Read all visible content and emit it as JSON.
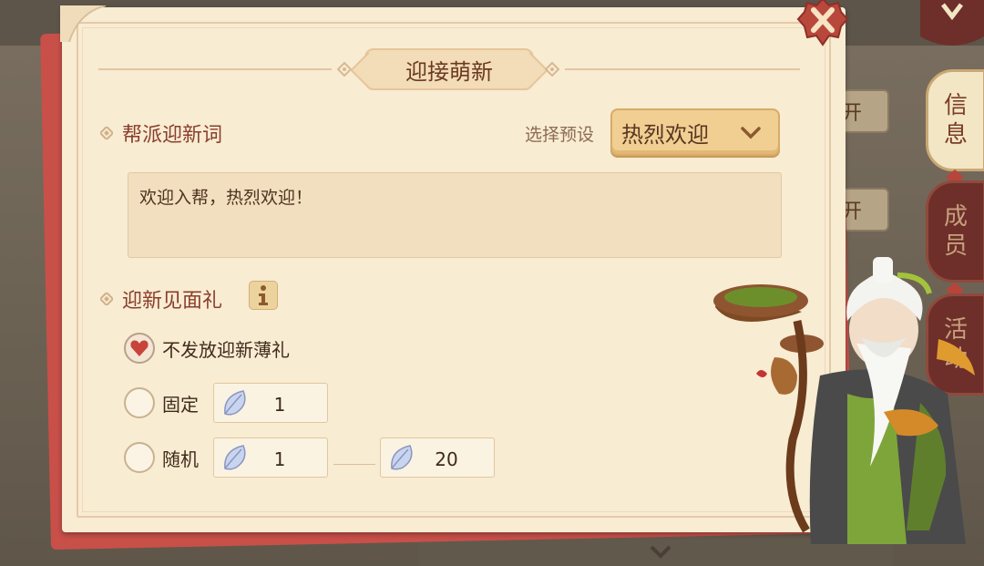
{
  "background": {
    "open_button_1": "开",
    "open_button_2": "开"
  },
  "side_tabs": [
    {
      "label_1": "信",
      "label_2": "息",
      "active": true
    },
    {
      "label_1": "成",
      "label_2": "员",
      "active": false
    },
    {
      "label_1": "活",
      "label_2": "动",
      "active": false
    }
  ],
  "dialog": {
    "title": "迎接萌新",
    "close_icon": "close-x-icon",
    "welcome_section": {
      "heading": "帮派迎新词",
      "preset_label": "选择预设",
      "preset_selected": "热烈欢迎",
      "message": "欢迎入帮，热烈欢迎！"
    },
    "gift_section": {
      "heading": "迎新见面礼",
      "info_icon": "info-icon",
      "options": [
        {
          "label": "不发放迎新薄礼",
          "selected": true
        },
        {
          "label": "固定",
          "selected": false,
          "value": "1"
        },
        {
          "label": "随机",
          "selected": false,
          "min": "1",
          "max": "20"
        }
      ]
    }
  },
  "colors": {
    "panel_bg": "#f8ecd2",
    "accent_red": "#c85049",
    "heading_text": "#8a3e2c",
    "select_bg": "#f1cf93"
  }
}
